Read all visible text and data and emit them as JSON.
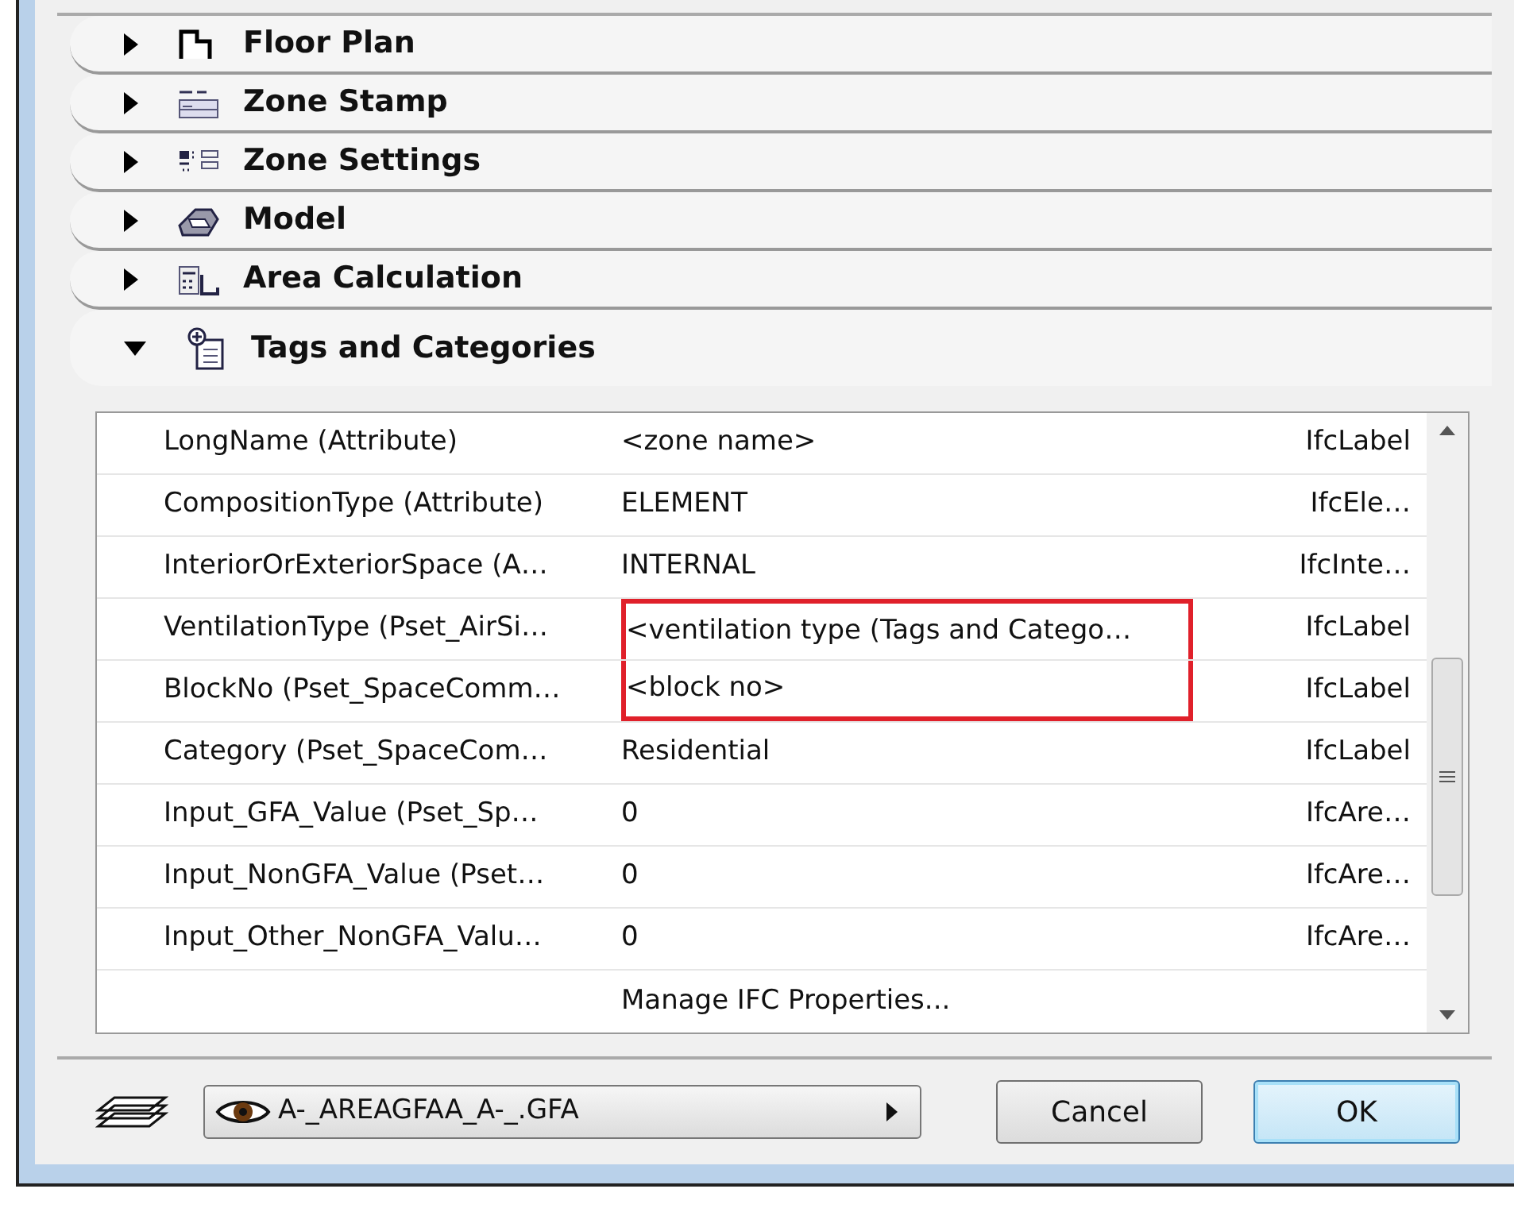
{
  "sections": [
    {
      "label": "Floor Plan",
      "expanded": false
    },
    {
      "label": "Zone Stamp",
      "expanded": false
    },
    {
      "label": "Zone Settings",
      "expanded": false
    },
    {
      "label": "Model",
      "expanded": false
    },
    {
      "label": "Area Calculation",
      "expanded": false
    },
    {
      "label": "Tags and Categories",
      "expanded": true
    }
  ],
  "properties": {
    "rows": [
      {
        "name": "LongName (Attribute)",
        "value": "<zone name>",
        "type": "IfcLabel",
        "highlighted": false
      },
      {
        "name": "CompositionType (Attribute)",
        "value": "ELEMENT",
        "type": "IfcEle…",
        "highlighted": false
      },
      {
        "name": "InteriorOrExteriorSpace (A…",
        "value": "INTERNAL",
        "type": "IfcInte…",
        "highlighted": false
      },
      {
        "name": "VentilationType (Pset_AirSi…",
        "value": "<ventilation type (Tags and Catego…",
        "type": "IfcLabel",
        "highlighted": true
      },
      {
        "name": "BlockNo (Pset_SpaceComm…",
        "value": "<block no>",
        "type": "IfcLabel",
        "highlighted": true
      },
      {
        "name": "Category (Pset_SpaceCom…",
        "value": "Residential",
        "type": "IfcLabel",
        "highlighted": false
      },
      {
        "name": "Input_GFA_Value (Pset_Sp…",
        "value": "0",
        "type": "IfcAre…",
        "highlighted": false
      },
      {
        "name": "Input_NonGFA_Value (Pset…",
        "value": "0",
        "type": "IfcAre…",
        "highlighted": false
      },
      {
        "name": "Input_Other_NonGFA_Valu…",
        "value": "0",
        "type": "IfcAre…",
        "highlighted": false
      }
    ],
    "manage_link": "Manage IFC Properties..."
  },
  "layer_select": {
    "value": "A-_AREAGFAA_A-_.GFA"
  },
  "buttons": [
    {
      "label": "Cancel",
      "default": false
    },
    {
      "label": "OK",
      "default": true
    }
  ]
}
